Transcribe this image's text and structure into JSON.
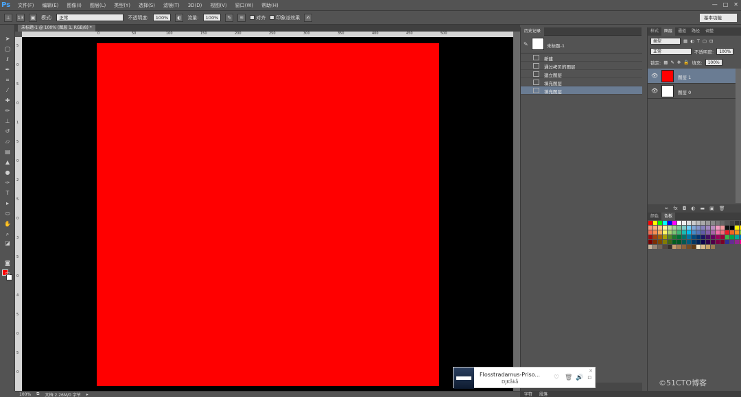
{
  "app": {
    "logo": "Ps"
  },
  "menu": [
    "文件(F)",
    "编辑(E)",
    "图像(I)",
    "图层(L)",
    "类型(Y)",
    "选择(S)",
    "滤镜(T)",
    "3D(D)",
    "视图(V)",
    "窗口(W)",
    "帮助(H)"
  ],
  "window_controls": [
    "—",
    "□",
    "✕"
  ],
  "options": {
    "size_value": "13",
    "mode_label": "模式:",
    "mode_value": "正常",
    "opacity_label": "不透明度:",
    "opacity_value": "100%",
    "flow_label": "流量:",
    "flow_value": "100%",
    "align_label": "对齐",
    "sample_label": "印象派效果",
    "workspace": "基本功能"
  },
  "document": {
    "tab": "未标题-1 @ 100% (图层 1, RGB/8) *",
    "ruler_top": [
      "0",
      "50",
      "100",
      "150",
      "200",
      "250",
      "300",
      "350",
      "400",
      "450",
      "500"
    ],
    "ruler_left": [
      "5",
      "0",
      "5",
      "0",
      "1",
      "5",
      "0",
      "2",
      "5",
      "0",
      "3",
      "5",
      "0",
      "4",
      "5",
      "0",
      "5",
      "0"
    ],
    "fill_color": "#ff0000",
    "pasteboard_color": "#000000"
  },
  "status": {
    "zoom": "100%",
    "doc_size": "文档:2.26M/0 字节"
  },
  "history": {
    "tab": "历史记录",
    "snapshot_name": "未标题-1",
    "steps": [
      {
        "label": "新建",
        "selected": false
      },
      {
        "label": "通过拷贝的图层",
        "selected": false
      },
      {
        "label": "建立图层",
        "selected": false
      },
      {
        "label": "填充图层",
        "selected": false
      },
      {
        "label": "填充图层",
        "selected": true
      }
    ]
  },
  "layers_panel": {
    "tabs": [
      "样式",
      "图层",
      "通道",
      "路径",
      "调整"
    ],
    "active_tab": "图层",
    "kind_filter": "类型",
    "blend_mode": "正常",
    "opacity_label": "不透明度:",
    "opacity_value": "100%",
    "lock_label": "锁定:",
    "fill_label": "填充:",
    "fill_value": "100%",
    "layers": [
      {
        "name": "图层 1",
        "thumb_color": "#ff0000",
        "selected": true
      },
      {
        "name": "图层 0",
        "thumb_color": "#ffffff",
        "selected": false
      }
    ],
    "footer_icons": [
      "link-icon",
      "fx-icon",
      "mask-icon",
      "adjustment-icon",
      "folder-icon",
      "new-layer-icon",
      "trash-icon"
    ]
  },
  "swatches_panel": {
    "tabs": [
      "颜色",
      "色板"
    ],
    "active_tab": "色板",
    "colors": [
      "#ff0000",
      "#ffff00",
      "#00ff00",
      "#00ffff",
      "#0000ff",
      "#ff00ff",
      "#ffffff",
      "#eeeeee",
      "#dddddd",
      "#cccccc",
      "#bbbbbb",
      "#aaaaaa",
      "#999999",
      "#888888",
      "#777777",
      "#666666",
      "#555555",
      "#444444",
      "#333333",
      "#222222",
      "#f7977a",
      "#f9ad81",
      "#fdc68a",
      "#fff79a",
      "#c4df9b",
      "#a2d39c",
      "#82ca9d",
      "#7bcdc8",
      "#6ecff6",
      "#7ea7d8",
      "#8493ca",
      "#8882be",
      "#a187be",
      "#bc8dbf",
      "#f49ac2",
      "#f6989d",
      "#111111",
      "#000000",
      "#fff200",
      "#ffd700",
      "#f26c4f",
      "#f68e55",
      "#fbaf5c",
      "#fff467",
      "#acd372",
      "#7cc576",
      "#3bb878",
      "#1abbb4",
      "#00bff3",
      "#438ccb",
      "#5574b9",
      "#605ca8",
      "#855fa8",
      "#a763a8",
      "#f06ea9",
      "#f26d7d",
      "#ed1c24",
      "#f26522",
      "#f7941d",
      "#8dc63f",
      "#9e0b0f",
      "#a0410d",
      "#a36209",
      "#aba000",
      "#598527",
      "#1a7b30",
      "#007236",
      "#00746b",
      "#0076a3",
      "#004b80",
      "#003471",
      "#1b1464",
      "#440e62",
      "#630460",
      "#9e005d",
      "#9e0039",
      "#39b54a",
      "#00a651",
      "#00a99d",
      "#0072bc",
      "#790000",
      "#7b2e00",
      "#7d4900",
      "#827b00",
      "#406618",
      "#005e20",
      "#005826",
      "#005952",
      "#005b7f",
      "#003663",
      "#002157",
      "#0d004c",
      "#32004b",
      "#4b0049",
      "#7b0046",
      "#7a0026",
      "#2e3192",
      "#662d91",
      "#92278f",
      "#ec008c",
      "#c7b299",
      "#998675",
      "#736357",
      "#534741",
      "#37302d",
      "#c69c6d",
      "#a67c52",
      "#8c6239",
      "#754c24",
      "#603913",
      "#f5e6c8",
      "#d9b98b",
      "#c8a36b",
      "#9b7b50"
    ]
  },
  "dock_bottom": [
    "字符",
    "段落"
  ],
  "music": {
    "title": "Flosstradamus-Priso...",
    "artist": "DJKåkå",
    "controls": [
      "heart-icon",
      "trash-icon",
      "volume-icon",
      "minimize-icon"
    ],
    "close": "✕"
  },
  "watermark": "©51CTO博客"
}
